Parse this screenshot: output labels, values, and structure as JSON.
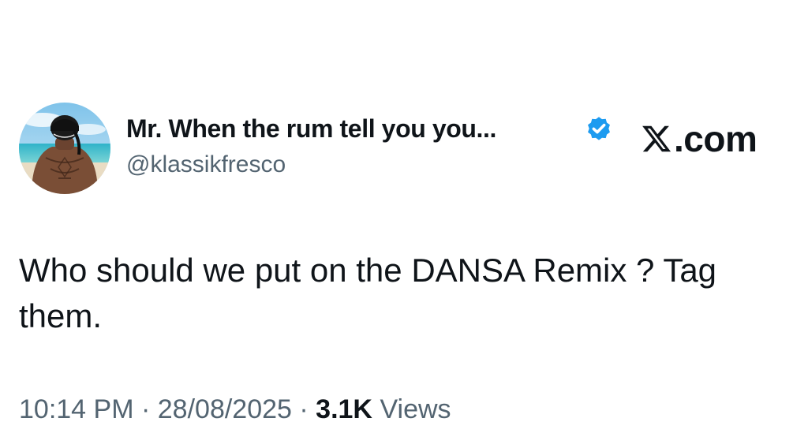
{
  "author": {
    "display_name": "Mr. When the rum tell you you...",
    "handle": "@klassikfresco",
    "verified": true,
    "avatar": "shirtless-man-on-beach-photo"
  },
  "brand": {
    "icon": "x-logo-icon",
    "text": ".com"
  },
  "tweet": {
    "text": "Who should we put on the DANSA Remix ? Tag them."
  },
  "meta": {
    "time": "10:14 PM",
    "separator": "·",
    "date": "28/08/2025",
    "views_count": "3.1K",
    "views_label": "Views"
  },
  "colors": {
    "text_primary": "#0f1419",
    "text_secondary": "#536471",
    "verified_blue": "#1d9bf0",
    "background": "#ffffff"
  }
}
